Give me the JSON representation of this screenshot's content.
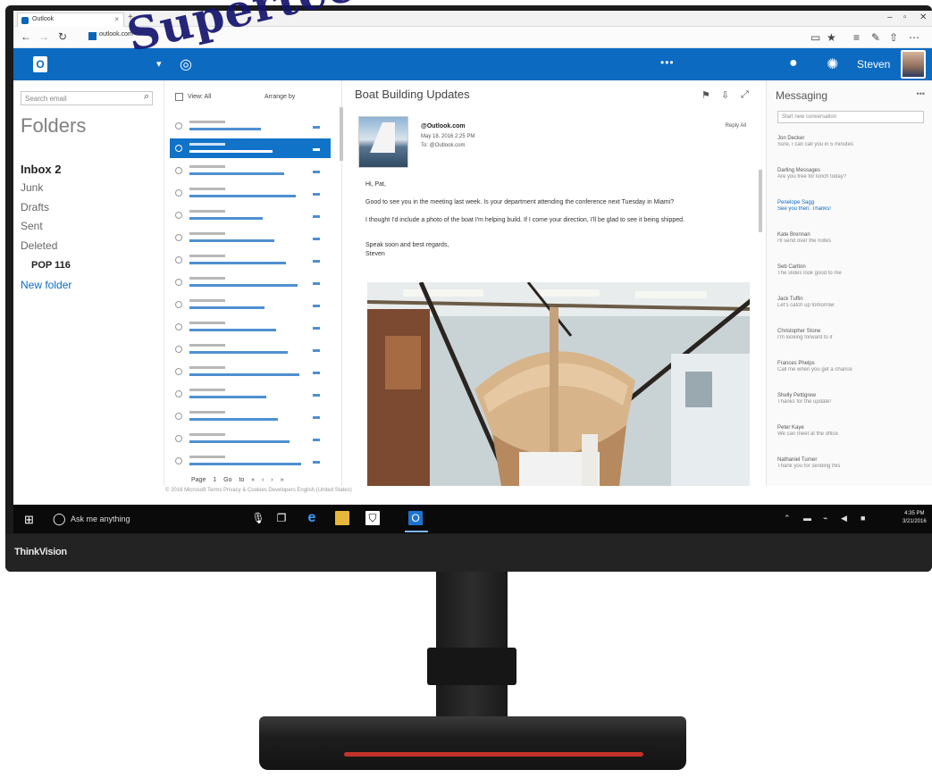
{
  "browser": {
    "tab_title": "Outlook",
    "tab_close": "×",
    "new_tab": "+",
    "url": "outlook.com"
  },
  "header": {
    "user_name": "Steven",
    "more": "•••"
  },
  "folder_pane": {
    "search_placeholder": "Search email",
    "title": "Folders",
    "folders": [
      {
        "label": "Inbox  2"
      },
      {
        "label": "Junk"
      },
      {
        "label": "Drafts"
      },
      {
        "label": "Sent"
      },
      {
        "label": "Deleted"
      }
    ],
    "pop_folder": "POP 116",
    "new_folder": "New folder"
  },
  "message_list": {
    "view_label": "View: All",
    "arrange_label": "Arrange by",
    "pager": "Page 1   Go to   «  ‹  ›  »"
  },
  "reading_pane": {
    "subject": "Boat Building Updates",
    "sender": "@Outlook.com",
    "date": "May 18, 2016     2:25 PM",
    "to": "To: @Outlook.com",
    "label": "Reply All",
    "greeting": "Hi, Pat,",
    "para1": "Good to see you in the meeting last week. Is your department attending the conference next Tuesday in Miami?",
    "para2": "I thought I'd include a photo of the boat I'm helping build. If I come your direction, I'll be glad to see it being shipped.",
    "signoff": "Speak soon and best regards,",
    "signature": "Steven"
  },
  "messaging_pane": {
    "title": "Messaging",
    "more": "•••",
    "search_placeholder": "Start new conversation",
    "contacts": [
      {
        "name": "Jon Decker",
        "line": "Sure, I can call you in 5 minutes"
      },
      {
        "name": "Darling Messages",
        "line": "Are you free for lunch today?"
      },
      {
        "name": "Penelope Sagg",
        "line": "See you then. Thanks!"
      },
      {
        "name": "Kate Brennan",
        "line": "I'll send over the notes"
      },
      {
        "name": "Seb Carlton",
        "line": "The slides look good to me"
      },
      {
        "name": "Jack Tuffin",
        "line": "Let's catch up tomorrow"
      },
      {
        "name": "Christopher Stone",
        "line": "I'm looking forward to it"
      },
      {
        "name": "Frances Phelps",
        "line": "Call me when you get a chance"
      },
      {
        "name": "Shelly Pettigrew",
        "line": "Thanks for the update!"
      },
      {
        "name": "Peter Kaye",
        "line": "We can meet at the office"
      },
      {
        "name": "Nathaniel Turner",
        "line": "Thank you for sending this"
      }
    ]
  },
  "status_line": "© 2016 Microsoft    Terms    Privacy & Cookies    Developers    English (United States)",
  "taskbar": {
    "search_text": "Ask me anything",
    "time": "4:35 PM",
    "date": "3/21/2016"
  },
  "monitor": {
    "brand": "ThinkVision"
  },
  "watermark": "Supertec",
  "colors": {
    "outlook_blue": "#0c6bc1",
    "selection_blue": "#1173c8",
    "taskbar": "#0a0a0a",
    "stand_accent": "#c2322b"
  }
}
